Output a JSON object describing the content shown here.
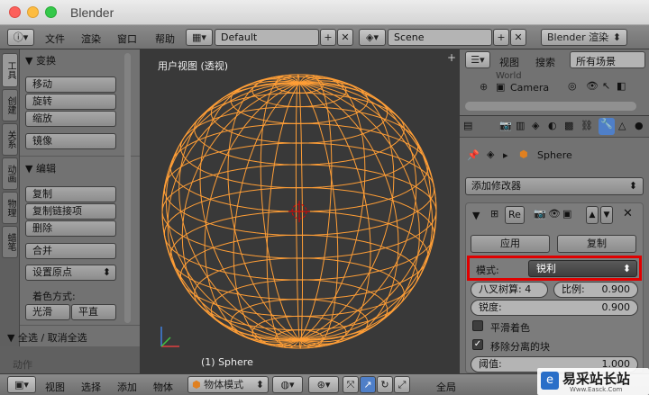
{
  "window": {
    "title": "Blender"
  },
  "info_header": {
    "menus": [
      "文件",
      "渲染",
      "窗口",
      "帮助"
    ],
    "screen_layout": "Default",
    "scene": "Scene",
    "render_engine": "Blender 渲染"
  },
  "tool_shelf": {
    "tabs": [
      "工具",
      "创建",
      "关系",
      "动画",
      "物理",
      "蜡笔"
    ],
    "transform": {
      "header": "▼ 变换",
      "buttons": [
        "移动",
        "旋转",
        "缩放",
        "镜像"
      ]
    },
    "edit": {
      "header": "▼ 编辑",
      "buttons": [
        "复制",
        "复制链接项",
        "删除",
        "合并"
      ],
      "set_origin": "设置原点"
    },
    "shading": {
      "label": "着色方式:",
      "smooth": "光滑",
      "flat": "平直"
    },
    "toggle_header": "▼ 全选 / 取消全选",
    "operator_label": "动作"
  },
  "viewport": {
    "view_label": "用户视图 (透视)",
    "object_label": "(1) Sphere"
  },
  "outliner": {
    "view_menu": "视图",
    "search_menu": "搜索",
    "filter": "所有场景",
    "items": [
      "World",
      "Camera"
    ]
  },
  "properties": {
    "breadcrumb_object": "Sphere",
    "add_modifier": "添加修改器",
    "modifier_name": "Re",
    "apply_label": "应用",
    "copy_label": "复制",
    "mode_label": "模式:",
    "mode_value": "锐利",
    "octree_label": "八叉树算:",
    "octree_value": "4",
    "scale_label": "比例:",
    "scale_value": "0.900",
    "sharpness_label": "锐度:",
    "sharpness_value": "0.900",
    "smooth_shading": "平滑着色",
    "remove_disconnected": "移除分离的块",
    "threshold_label": "阈值:",
    "threshold_value": "1.000"
  },
  "bottom_bar": {
    "menus": [
      "视图",
      "选择",
      "添加",
      "物体"
    ],
    "mode": "物体模式",
    "global": "全局"
  },
  "watermark": {
    "text": "易采站长站",
    "sub": "Www.Easck.Com"
  },
  "colors": {
    "wire": "#ff9e36",
    "highlight": "#e00000",
    "active_blue": "#4f7fc8"
  }
}
